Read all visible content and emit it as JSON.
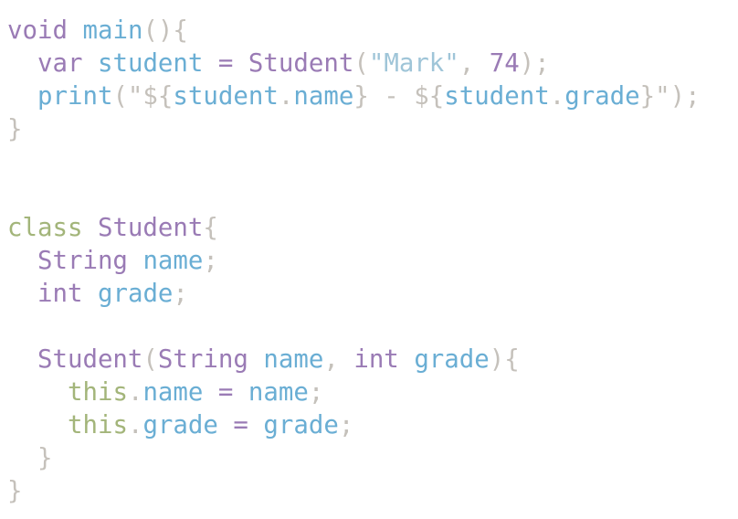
{
  "colors": {
    "keyword": "#9a7bb5",
    "identifier": "#6aaed4",
    "class_keyword": "#a3b57a",
    "punctuation": "#c5c1bb",
    "string": "#9fc5d8",
    "number": "#9a7bb5",
    "background": "#ffffff"
  },
  "lines": [
    [
      {
        "t": "void",
        "c": "keyword"
      },
      {
        "t": " ",
        "c": "punctuation"
      },
      {
        "t": "main",
        "c": "identifier"
      },
      {
        "t": "(){",
        "c": "punctuation"
      }
    ],
    [
      {
        "t": "  ",
        "c": "punctuation"
      },
      {
        "t": "var",
        "c": "keyword"
      },
      {
        "t": " ",
        "c": "punctuation"
      },
      {
        "t": "student",
        "c": "identifier"
      },
      {
        "t": " ",
        "c": "punctuation"
      },
      {
        "t": "=",
        "c": "keyword"
      },
      {
        "t": " ",
        "c": "punctuation"
      },
      {
        "t": "Student",
        "c": "keyword"
      },
      {
        "t": "(",
        "c": "punctuation"
      },
      {
        "t": "\"Mark\"",
        "c": "string"
      },
      {
        "t": ", ",
        "c": "punctuation"
      },
      {
        "t": "74",
        "c": "number"
      },
      {
        "t": ");",
        "c": "punctuation"
      }
    ],
    [
      {
        "t": "  ",
        "c": "punctuation"
      },
      {
        "t": "print",
        "c": "identifier"
      },
      {
        "t": "(\"${",
        "c": "punctuation"
      },
      {
        "t": "student",
        "c": "identifier"
      },
      {
        "t": ".",
        "c": "punctuation"
      },
      {
        "t": "name",
        "c": "identifier"
      },
      {
        "t": "} - ${",
        "c": "punctuation"
      },
      {
        "t": "student",
        "c": "identifier"
      },
      {
        "t": ".",
        "c": "punctuation"
      },
      {
        "t": "grade",
        "c": "identifier"
      },
      {
        "t": "}\");",
        "c": "punctuation"
      }
    ],
    [
      {
        "t": "}",
        "c": "punctuation"
      }
    ],
    [],
    [],
    [
      {
        "t": "class",
        "c": "class_keyword"
      },
      {
        "t": " ",
        "c": "punctuation"
      },
      {
        "t": "Student",
        "c": "keyword"
      },
      {
        "t": "{",
        "c": "punctuation"
      }
    ],
    [
      {
        "t": "  ",
        "c": "punctuation"
      },
      {
        "t": "String",
        "c": "keyword"
      },
      {
        "t": " ",
        "c": "punctuation"
      },
      {
        "t": "name",
        "c": "identifier"
      },
      {
        "t": ";",
        "c": "punctuation"
      }
    ],
    [
      {
        "t": "  ",
        "c": "punctuation"
      },
      {
        "t": "int",
        "c": "keyword"
      },
      {
        "t": " ",
        "c": "punctuation"
      },
      {
        "t": "grade",
        "c": "identifier"
      },
      {
        "t": ";",
        "c": "punctuation"
      }
    ],
    [],
    [
      {
        "t": "  ",
        "c": "punctuation"
      },
      {
        "t": "Student",
        "c": "keyword"
      },
      {
        "t": "(",
        "c": "punctuation"
      },
      {
        "t": "String",
        "c": "keyword"
      },
      {
        "t": " ",
        "c": "punctuation"
      },
      {
        "t": "name",
        "c": "identifier"
      },
      {
        "t": ", ",
        "c": "punctuation"
      },
      {
        "t": "int",
        "c": "keyword"
      },
      {
        "t": " ",
        "c": "punctuation"
      },
      {
        "t": "grade",
        "c": "identifier"
      },
      {
        "t": "){",
        "c": "punctuation"
      }
    ],
    [
      {
        "t": "    ",
        "c": "punctuation"
      },
      {
        "t": "this",
        "c": "class_keyword"
      },
      {
        "t": ".",
        "c": "punctuation"
      },
      {
        "t": "name",
        "c": "identifier"
      },
      {
        "t": " ",
        "c": "punctuation"
      },
      {
        "t": "=",
        "c": "keyword"
      },
      {
        "t": " ",
        "c": "punctuation"
      },
      {
        "t": "name",
        "c": "identifier"
      },
      {
        "t": ";",
        "c": "punctuation"
      }
    ],
    [
      {
        "t": "    ",
        "c": "punctuation"
      },
      {
        "t": "this",
        "c": "class_keyword"
      },
      {
        "t": ".",
        "c": "punctuation"
      },
      {
        "t": "grade",
        "c": "identifier"
      },
      {
        "t": " ",
        "c": "punctuation"
      },
      {
        "t": "=",
        "c": "keyword"
      },
      {
        "t": " ",
        "c": "punctuation"
      },
      {
        "t": "grade",
        "c": "identifier"
      },
      {
        "t": ";",
        "c": "punctuation"
      }
    ],
    [
      {
        "t": "  }",
        "c": "punctuation"
      }
    ],
    [
      {
        "t": "}",
        "c": "punctuation"
      }
    ]
  ]
}
